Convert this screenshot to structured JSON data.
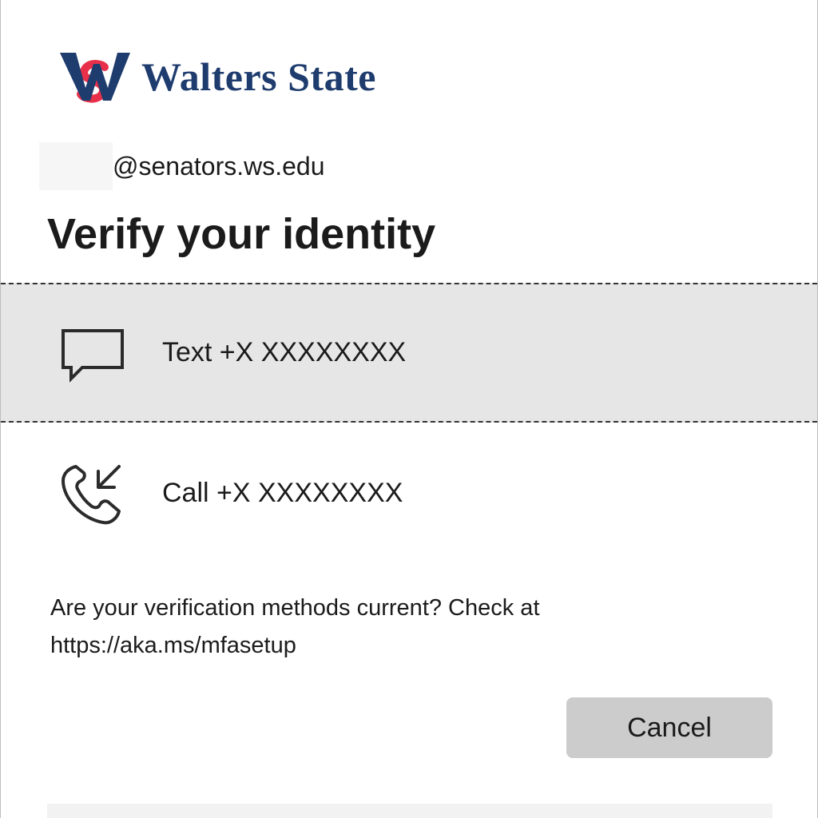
{
  "brand": {
    "logo_monogram": "WS",
    "name": "Walters State",
    "colors": {
      "navy": "#1f3c6e",
      "red": "#e8304a"
    }
  },
  "account": {
    "domain": "@senators.ws.edu"
  },
  "title": "Verify your identity",
  "options": [
    {
      "icon": "chat-bubble-icon",
      "label": "Text +X XXXXXXXX",
      "selected": true
    },
    {
      "icon": "incoming-call-icon",
      "label": "Call +X XXXXXXXX",
      "selected": false
    }
  ],
  "note": {
    "line1": "Are your verification methods current? Check at",
    "line2": "https://aka.ms/mfasetup"
  },
  "cancel_label": "Cancel"
}
